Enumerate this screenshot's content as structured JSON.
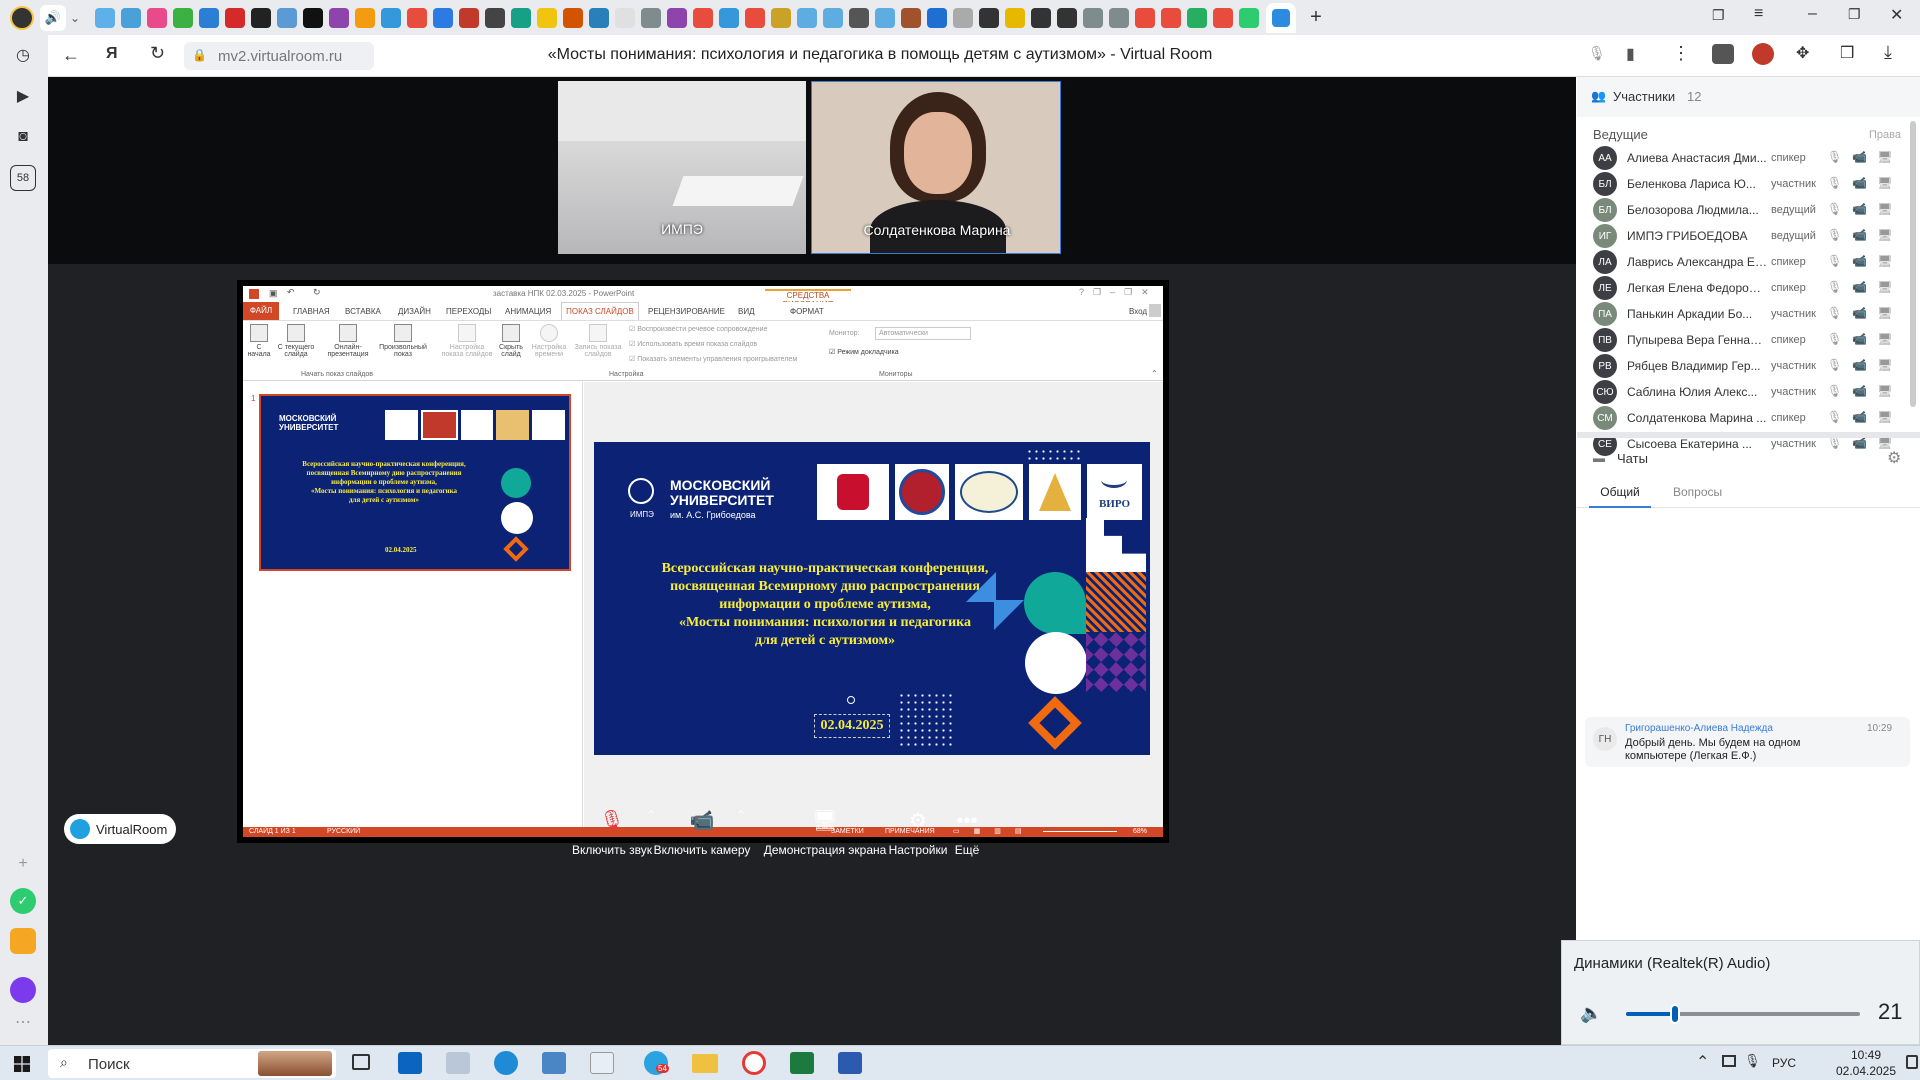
{
  "browser": {
    "url": "mv2.virtualroom.ru",
    "page_title": "«Мосты понимания: психология и педагогика в помощь детям с аутизмом» - Virtual Room",
    "yandex_label": "Я",
    "side_badge": "58"
  },
  "video": {
    "tile1_name": "ИМПЭ",
    "tile2_name": "Солдатенкова Марина"
  },
  "ppt": {
    "title": "заставка НПК 02.03.2025 - PowerPoint",
    "drawing_tools": "СРЕДСТВА РИСОВАНИЯ",
    "login": "Вход",
    "tabs": [
      "ФАЙЛ",
      "ГЛАВНАЯ",
      "ВСТАВКА",
      "ДИЗАЙН",
      "ПЕРЕХОДЫ",
      "АНИМАЦИЯ",
      "ПОКАЗ СЛАЙДОВ",
      "РЕЦЕНЗИРОВАНИЕ",
      "ВИД",
      "ФОРМАТ"
    ],
    "ribbon": {
      "btn_from_start": "С начала",
      "btn_from_current": "С текущего слайда",
      "btn_online": "Онлайн-презентация",
      "btn_custom": "Произвольный показ",
      "btn_setup": "Настройка показа слайдов",
      "btn_hide": "Скрыть слайд",
      "btn_timings": "Настройка времени",
      "btn_record": "Запись показа слайдов",
      "chk1": "Воспроизвести речевое сопровождение",
      "chk2": "Использовать время показа слайдов",
      "chk3": "Показать элементы управления проигрывателем",
      "monitor_label": "Монитор:",
      "monitor_value": "Автоматически",
      "presenter_mode": "Режим докладчика",
      "group1": "Начать показ слайдов",
      "group2": "Настройка",
      "group3": "Мониторы"
    },
    "slide_number": "1",
    "status": {
      "slide": "СЛАЙД 1 ИЗ 1",
      "lang": "РУССКИЙ",
      "notes": "ЗАМЕТКИ",
      "comments": "ПРИМЕЧАНИЯ",
      "zoom": "68%"
    }
  },
  "slide": {
    "uni_line1": "МОСКОВСКИЙ",
    "uni_line2": "УНИВЕРСИТЕТ",
    "uni_sub1": "ИМПЭ",
    "uni_sub2": "им. А.С. Грибоедова",
    "viro": "ВИРО",
    "text_lines": [
      "Всероссийская научно-практическая конференция,",
      "посвященная  Всемирному дню распространения",
      "информации о проблеме аутизма,",
      "«Мосты понимания: психология и педагогика",
      "для детей с аутизмом»"
    ],
    "date": "02.04.2025"
  },
  "controls": {
    "logo": "VirtualRoom",
    "mic": "Включить звук",
    "cam": "Включить камеру",
    "screen": "Демонстрация экрана",
    "settings": "Настройки",
    "more": "Ещё"
  },
  "participants": {
    "header": "Участники",
    "count": "12",
    "section": "Ведущие",
    "rights": "Права",
    "list": [
      {
        "initials": "АА",
        "name": "Алиева Анастасия Дми...",
        "role": "спикер",
        "color": "#3d3f44"
      },
      {
        "initials": "БЛ",
        "name": "Беленкова Лариса Ю...",
        "role": "участник",
        "color": "#3d3f44"
      },
      {
        "initials": "БЛ",
        "name": "Белозорова Людмила...",
        "role": "ведущий",
        "color": "#7a8a7a"
      },
      {
        "initials": "ИГ",
        "name": "ИМПЭ ГРИБОЕДОВА",
        "role": "ведущий",
        "color": "#7a8a7a"
      },
      {
        "initials": "ЛА",
        "name": "Лаврись Александра Ев...",
        "role": "спикер",
        "color": "#3d3f44"
      },
      {
        "initials": "ЛЕ",
        "name": "Легкая Елена Федоровна",
        "role": "спикер",
        "color": "#3d3f44"
      },
      {
        "initials": "ПА",
        "name": "Панькин Аркадии Бо...",
        "role": "участник",
        "color": "#7a8a7a"
      },
      {
        "initials": "ПВ",
        "name": "Пупырева Вера Геннадь...",
        "role": "спикер",
        "color": "#3d3f44"
      },
      {
        "initials": "РВ",
        "name": "Рябцев Владимир Гер...",
        "role": "участник",
        "color": "#3d3f44"
      },
      {
        "initials": "СЮ",
        "name": "Саблина Юлия Алекс...",
        "role": "участник",
        "color": "#3d3f44"
      },
      {
        "initials": "СМ",
        "name": "Солдатенкова Марина ...",
        "role": "спикер",
        "color": "#7a8a7a"
      },
      {
        "initials": "СЕ",
        "name": "Сысоева Екатерина ...",
        "role": "участник",
        "color": "#3d3f44"
      }
    ]
  },
  "chat": {
    "header": "Чаты",
    "tab_general": "Общий",
    "tab_questions": "Вопросы",
    "msg_avatar": "ГН",
    "msg_author": "Григорашенко-Алиева Надежда",
    "msg_time": "10:29",
    "msg_text": "Добрый день. Мы будем на одном компьютере (Легкая Е.Ф.)"
  },
  "volume": {
    "device": "Динамики (Realtek(R) Audio)",
    "level": 21,
    "fill": 0.21
  },
  "taskbar": {
    "search": "Поиск",
    "lang": "РУС",
    "time": "10:49",
    "date": "02.04.2025",
    "badge": "54"
  }
}
